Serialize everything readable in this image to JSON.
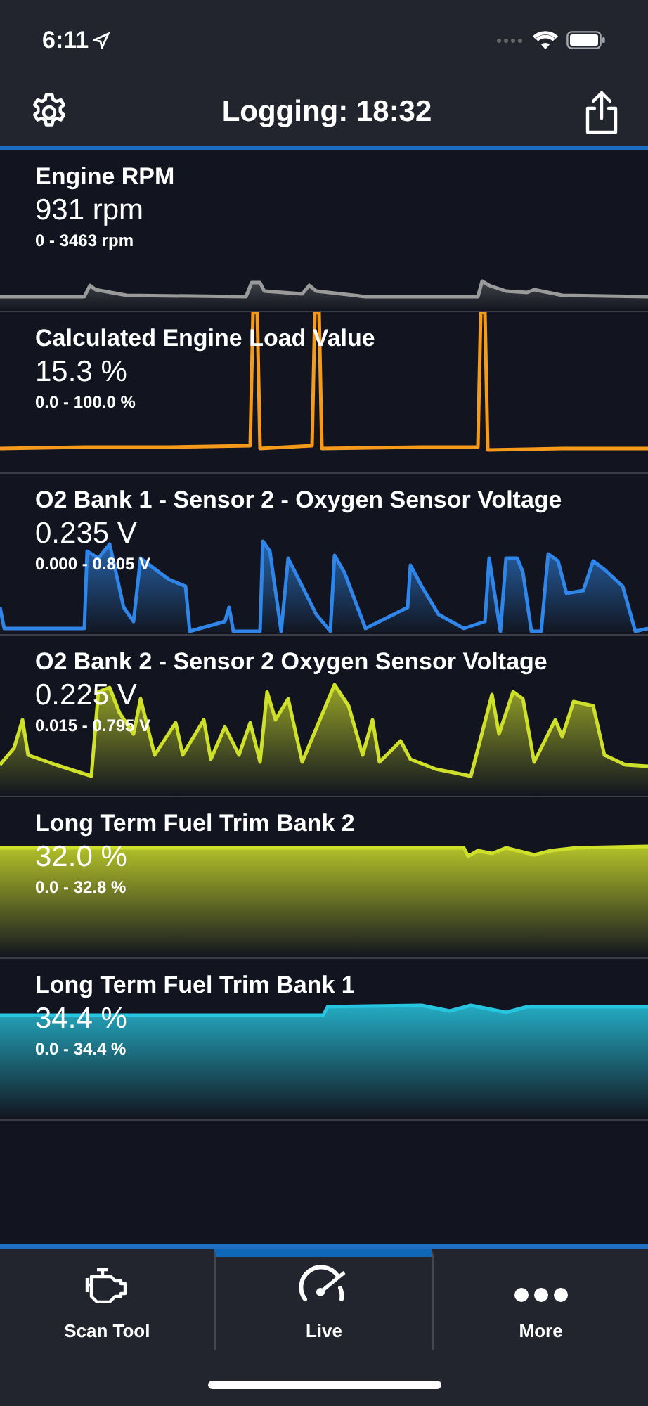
{
  "status_bar": {
    "time": "6:11"
  },
  "header": {
    "title": "Logging: 18:32"
  },
  "gauges": [
    {
      "name": "Engine RPM",
      "value": "931 rpm",
      "range": "0 - 3463 rpm",
      "color": "#9a9a9a"
    },
    {
      "name": "Calculated Engine Load Value",
      "value": "15.3 %",
      "range": "0.0 - 100.0 %",
      "color": "#f59a1b"
    },
    {
      "name": "O2 Bank 1 - Sensor 2 - Oxygen Sensor Voltage",
      "value": "0.235 V",
      "range": "0.000 - 0.805 V",
      "color": "#2f86e8"
    },
    {
      "name": "O2 Bank 2 - Sensor 2 Oxygen Sensor Voltage",
      "value": "0.225 V",
      "range": "0.015 - 0.795 V",
      "color": "#cfe02a"
    },
    {
      "name": "Long Term Fuel Trim Bank 2",
      "value": "32.0 %",
      "range": "0.0 - 32.8 %",
      "color": "#cfe02a"
    },
    {
      "name": "Long Term Fuel Trim Bank 1",
      "value": "34.4 %",
      "range": "0.0 - 34.4 %",
      "color": "#27c6e0"
    }
  ],
  "tabs": [
    {
      "label": "Scan Tool",
      "selected": false
    },
    {
      "label": "Live",
      "selected": true
    },
    {
      "label": "More",
      "selected": false
    }
  ]
}
